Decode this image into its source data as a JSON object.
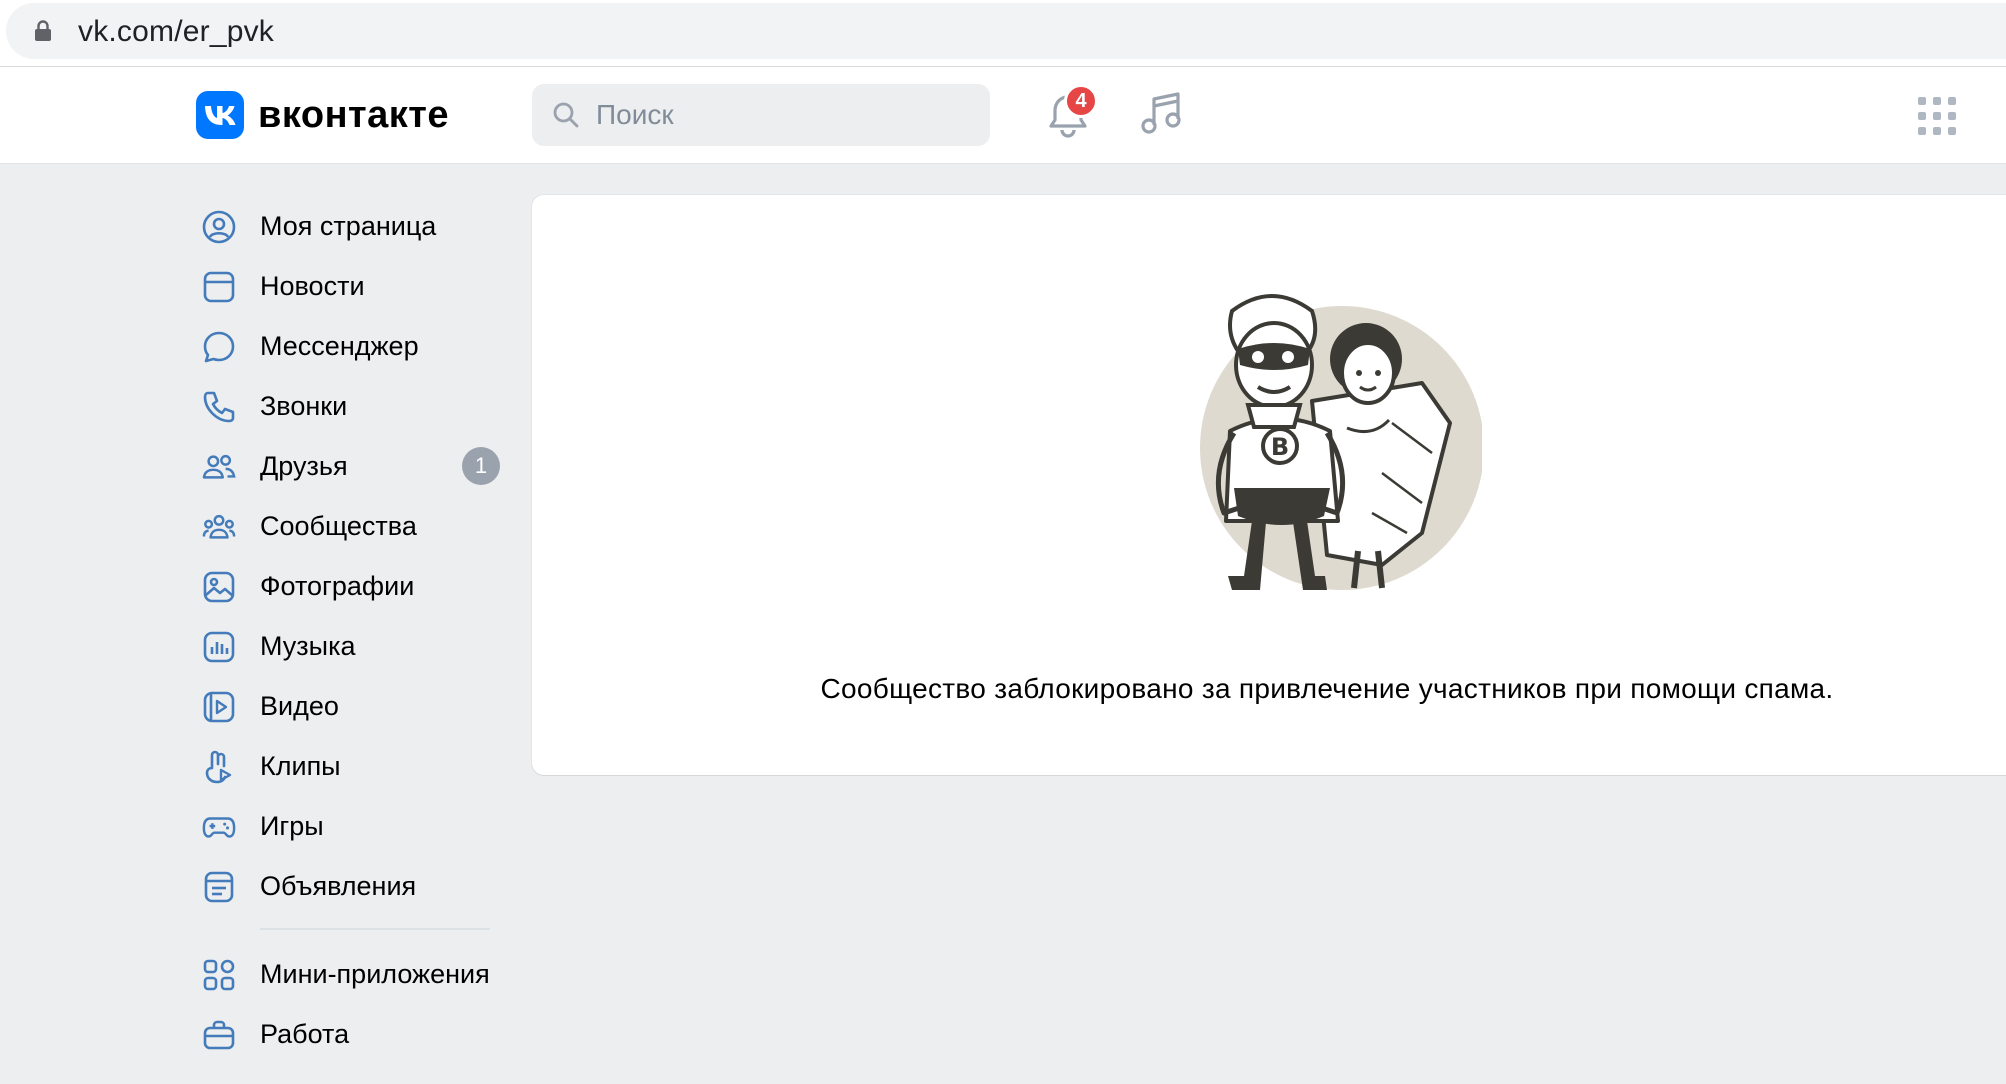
{
  "browser": {
    "url": "vk.com/er_pvk"
  },
  "header": {
    "logo_text": "вконтакте",
    "search_placeholder": "Поиск",
    "notifications_count": "4"
  },
  "sidebar": {
    "items": [
      {
        "label": "Моя страница",
        "icon": "user-circle-icon"
      },
      {
        "label": "Новости",
        "icon": "newsfeed-icon"
      },
      {
        "label": "Мессенджер",
        "icon": "message-icon"
      },
      {
        "label": "Звонки",
        "icon": "phone-icon"
      },
      {
        "label": "Друзья",
        "icon": "friends-icon",
        "counter": "1"
      },
      {
        "label": "Сообщества",
        "icon": "communities-icon"
      },
      {
        "label": "Фотографии",
        "icon": "photo-icon"
      },
      {
        "label": "Музыка",
        "icon": "music-icon"
      },
      {
        "label": "Видео",
        "icon": "video-icon"
      },
      {
        "label": "Клипы",
        "icon": "clips-icon"
      },
      {
        "label": "Игры",
        "icon": "gamepad-icon"
      },
      {
        "label": "Объявления",
        "icon": "ads-icon"
      }
    ],
    "extra_items": [
      {
        "label": "Мини-приложения",
        "icon": "apps-icon"
      },
      {
        "label": "Работа",
        "icon": "briefcase-icon"
      }
    ]
  },
  "main": {
    "message": "Сообщество заблокировано за привлечение участников при помощи спама."
  },
  "colors": {
    "brand": "#0077ff",
    "icon": "#447bba",
    "badge_red": "#e64646",
    "counter_gray": "#99a2ad",
    "background": "#edeef0"
  }
}
